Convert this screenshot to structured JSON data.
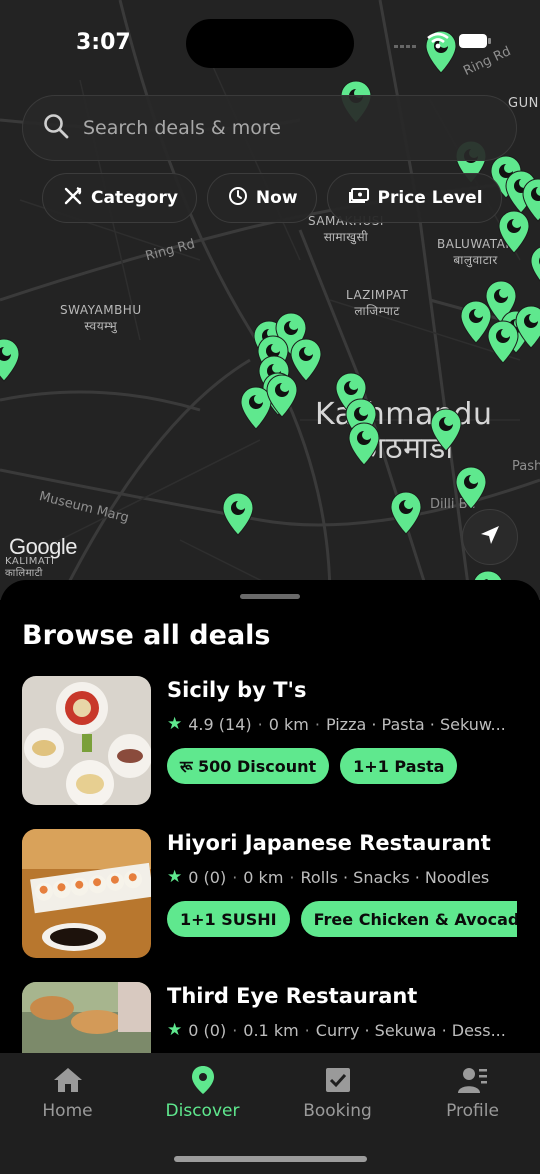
{
  "status_bar": {
    "time": "3:07"
  },
  "search": {
    "placeholder": "Search deals & more"
  },
  "filters": [
    {
      "label": "Category",
      "icon": "utensils-icon"
    },
    {
      "label": "Now",
      "icon": "clock-icon"
    },
    {
      "label": "Price Level",
      "icon": "money-icon"
    }
  ],
  "map": {
    "labels": {
      "ring_rd_1": "Ring Rd",
      "ring_rd_2": "Ring Rd",
      "samakhusi": "SAMAKHUSI",
      "samakhusi_ne": "सामाखुसी",
      "baluwatar": "BALUWATAR",
      "baluwatar_ne": "बालुवाटार",
      "swayambhu": "SWAYAMBHU",
      "swayambhu_ne": "स्वयम्भु",
      "lazimpat": "LAZIMPAT",
      "lazimpat_ne": "लाजिम्पाट",
      "kathmandu": "Kathmandu",
      "kathmandu_ne": "काठमाडौं",
      "museum_marg": "Museum Marg",
      "dilli_bazar": "Dilli Ba",
      "kalimati": "KALIMATI",
      "kalimati_ne": "कालिमाटी",
      "gun": "GUN",
      "pash": "Pash"
    },
    "attribution": "Google",
    "pin_color": "#5fe88e"
  },
  "sheet": {
    "title": "Browse all deals",
    "deals": [
      {
        "name": "Sicily by T's",
        "rating": "4.9 (14)",
        "distance": "0 km",
        "cuisines": "Pizza · Pasta · Sekuw...",
        "tags": [
          "रू 500 Discount",
          "1+1 Pasta"
        ]
      },
      {
        "name": "Hiyori Japanese Restaurant",
        "rating": "0 (0)",
        "distance": "0 km",
        "cuisines": "Rolls · Snacks · Noodles",
        "tags": [
          "1+1 SUSHI",
          "Free Chicken & Avocado S"
        ]
      },
      {
        "name": "Third Eye Restaurant",
        "rating": "0 (0)",
        "distance": "0.1 km",
        "cuisines": "Curry · Sekuwa · Dess...",
        "tags": []
      }
    ]
  },
  "tabs": [
    {
      "label": "Home",
      "icon": "home-icon"
    },
    {
      "label": "Discover",
      "icon": "map-pin-icon",
      "active": true
    },
    {
      "label": "Booking",
      "icon": "checkbox-icon"
    },
    {
      "label": "Profile",
      "icon": "profile-icon"
    }
  ],
  "colors": {
    "accent": "#5fe88e",
    "background": "#000000",
    "map": "#232323"
  }
}
